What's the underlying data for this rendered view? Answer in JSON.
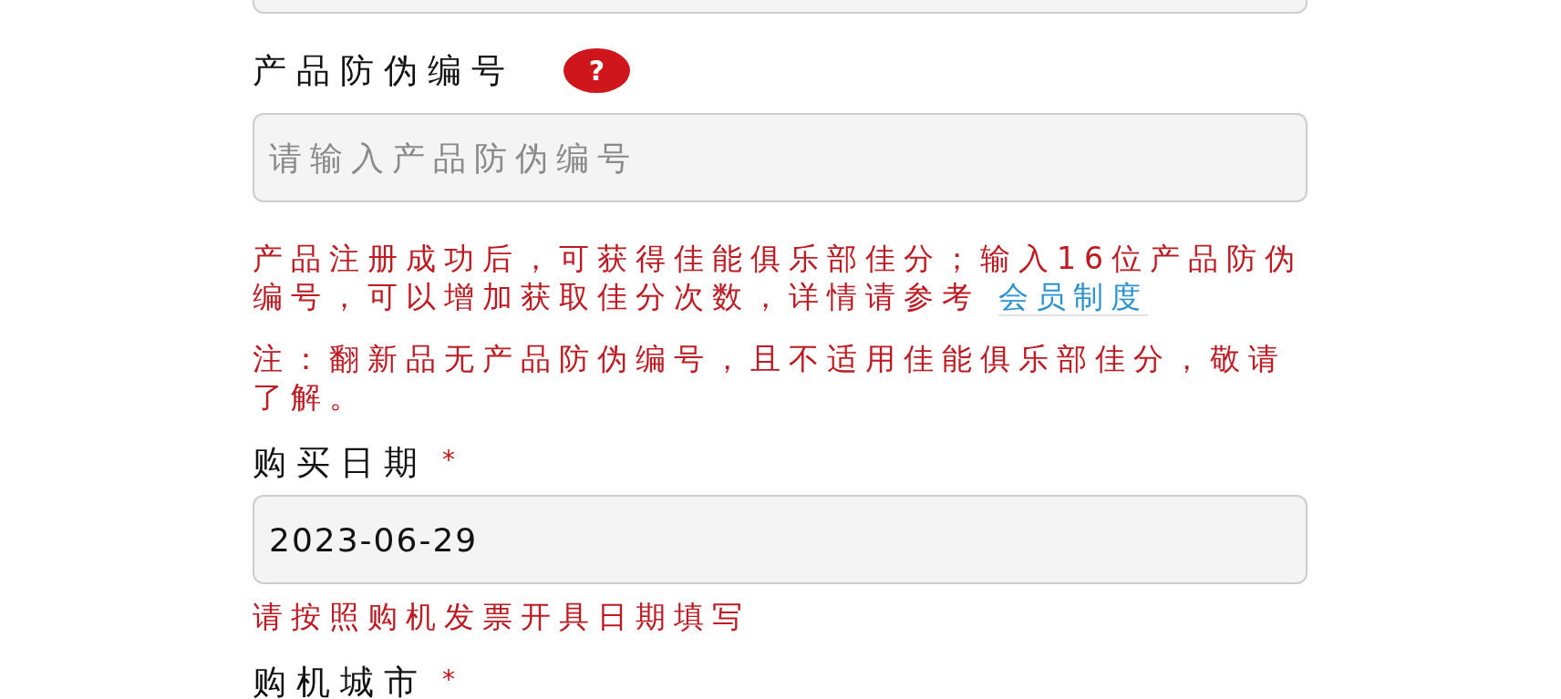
{
  "fields": [
    {
      "input": true
    },
    {
      "label": "产品防伪编号",
      "help": "?",
      "input": true,
      "placeholder": "请输入产品防伪编号",
      "notes": [
        {
          "text": "产品注册成功后，可获得佳能俱乐部佳分；输入16位产品防伪编号，可以增加获取佳分次数，详情请参考",
          "link": "会员制度"
        },
        {
          "text": "注：翻新品无产品防伪编号，且不适用佳能俱乐部佳分，敬请了解。"
        }
      ]
    },
    {
      "label": "购买日期",
      "required_mark": "*",
      "input": true,
      "value": "2023-06-29",
      "notes": [
        {
          "text": "请按照购机发票开具日期填写"
        }
      ]
    },
    {
      "label": "购机城市",
      "required_mark": "*"
    }
  ]
}
